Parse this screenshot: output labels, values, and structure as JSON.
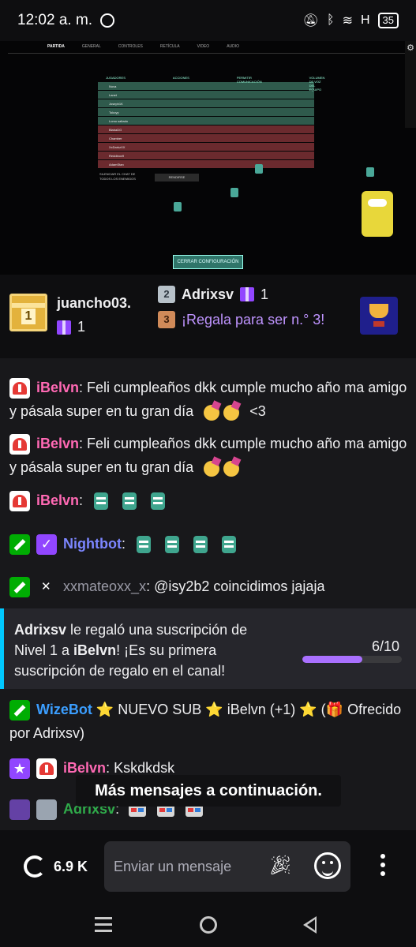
{
  "status_bar": {
    "time": "12:02 a. m.",
    "signal": "H",
    "battery": "35"
  },
  "video": {
    "tabs": [
      "PARTIDA",
      "GENERAL",
      "CONTROLES",
      "RETÍCULA",
      "VIDEO",
      "AUDIO"
    ],
    "active_tab": "PARTIDA",
    "score_cols": [
      "JUGADORES",
      "ACCIONES",
      "PERMITIR COMUNICACIÓN",
      "VOLUMEN DE VOZ DEL EQUIPO"
    ],
    "players": [
      "Nova",
      "Lanet",
      "Joseph1K",
      "Tokoyy",
      "Lomo saltado",
      "BlabaDG",
      "Chamber",
      "XxDarkzXX",
      "Reddinox9",
      "AdamStan"
    ],
    "side_text": "SILENCIAR EL CHAT DE TODOS LOS ENEMIGOS",
    "side_button": "RENDIRSE",
    "close_button": "CERRAR CONFIGURACIÓN"
  },
  "leaderboard": {
    "first": {
      "rank": "1",
      "name": "juancho03.",
      "count": "1"
    },
    "second": {
      "rank": "2",
      "name": "Adrixsv",
      "count": "1"
    },
    "third": {
      "rank": "3",
      "cta": "¡Regala para ser n.° 3!"
    }
  },
  "chat": {
    "messages": [
      {
        "user": "iBelvn",
        "text": ": Feli cumpleaños dkk cumple mucho año ma amigo y pásala super en tu gran día",
        "tail": "<3"
      },
      {
        "user": "iBelvn",
        "text": ": Feli cumpleaños dkk cumple mucho año ma amigo y pásala super en tu gran día"
      },
      {
        "user": "iBelvn",
        "text": ":"
      },
      {
        "user": "Nightbot",
        "text": ":"
      },
      {
        "user": "xxmateoxx_x",
        "text": ": @isy2b2 coincidimos jajaja"
      },
      {
        "user": "WizeBot",
        "text": "⭐ NUEVO SUB ⭐ iBelvn (+1) ⭐ (🎁 Ofrecido por Adrixsv)"
      },
      {
        "user": "iBelvn",
        "text": ": Kskdkdsk"
      },
      {
        "user": "Adrixsv",
        "text": ":"
      }
    ],
    "notice": {
      "gifter": "Adrixsv",
      "t1": " le regaló una suscripción de Nivel 1 a ",
      "recipient": "iBelvn",
      "t2": "! ¡Es su primera suscripción de regalo en el canal!",
      "goal_label": "6/10",
      "goal_fraction": 0.6
    },
    "more_messages": "Más mensajes a continuación."
  },
  "input_bar": {
    "viewer_count": "6.9 K",
    "placeholder": "Enviar un mensaje"
  },
  "icons": [
    "whatsapp-icon",
    "mute-icon",
    "bluetooth-icon",
    "wifi-icon",
    "battery-icon",
    "gear-icon",
    "gift-icon",
    "trophy-icon",
    "viewers-icon",
    "party-popper-icon",
    "emote-icon",
    "more-icon",
    "recents-icon",
    "home-icon",
    "back-icon"
  ]
}
